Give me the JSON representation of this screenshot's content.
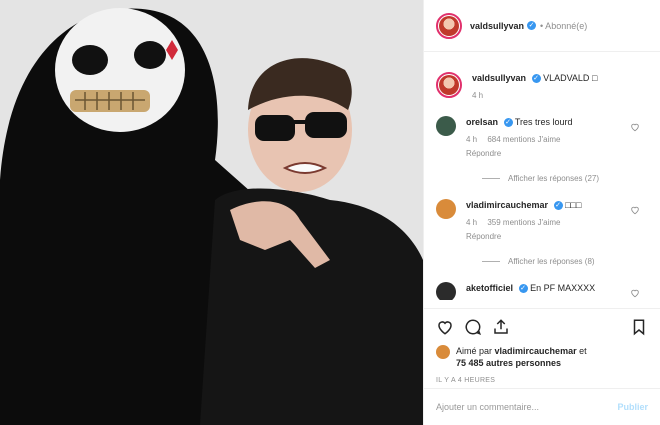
{
  "post": {
    "username": "valdsullyvan",
    "follow_status": "• Abonné(e)",
    "caption": "VLADVALD",
    "caption_emoji": "□",
    "caption_age": "4 h",
    "image_alt": "Photo: person in skeleton mask with a man in sunglasses"
  },
  "comments": [
    {
      "username": "orelsan",
      "text": "Tres tres lourd",
      "age": "4 h",
      "likes": "684 mentions J'aime",
      "reply": "Répondre",
      "view_replies": "Afficher les réponses (27)",
      "avatar_color": "#3b5b4a"
    },
    {
      "username": "vladimircauchemar",
      "text": "□□□",
      "age": "4 h",
      "likes": "359 mentions J'aime",
      "reply": "Répondre",
      "view_replies": "Afficher les réponses (8)",
      "avatar_color": "#d98b3a"
    },
    {
      "username": "aketofficiel",
      "text": "En PF MAXXXX",
      "avatar_color": "#2b2b2b"
    }
  ],
  "likes": {
    "prefix": "Aimé par",
    "user": "vladimircauchemar",
    "suffix": "et",
    "others": "75 485 autres personnes"
  },
  "timestamp": "IL Y A 4 HEURES",
  "add_comment": {
    "placeholder": "Ajouter un commentaire...",
    "publish": "Publier"
  },
  "colors": {
    "verified": "#3897f0",
    "publish_disabled": "#b2dffc",
    "muted": "#8e8e8e",
    "story_ring": "#e1306c"
  },
  "icons": [
    "heart-icon",
    "comment-icon",
    "share-icon",
    "bookmark-icon",
    "verified-icon"
  ]
}
